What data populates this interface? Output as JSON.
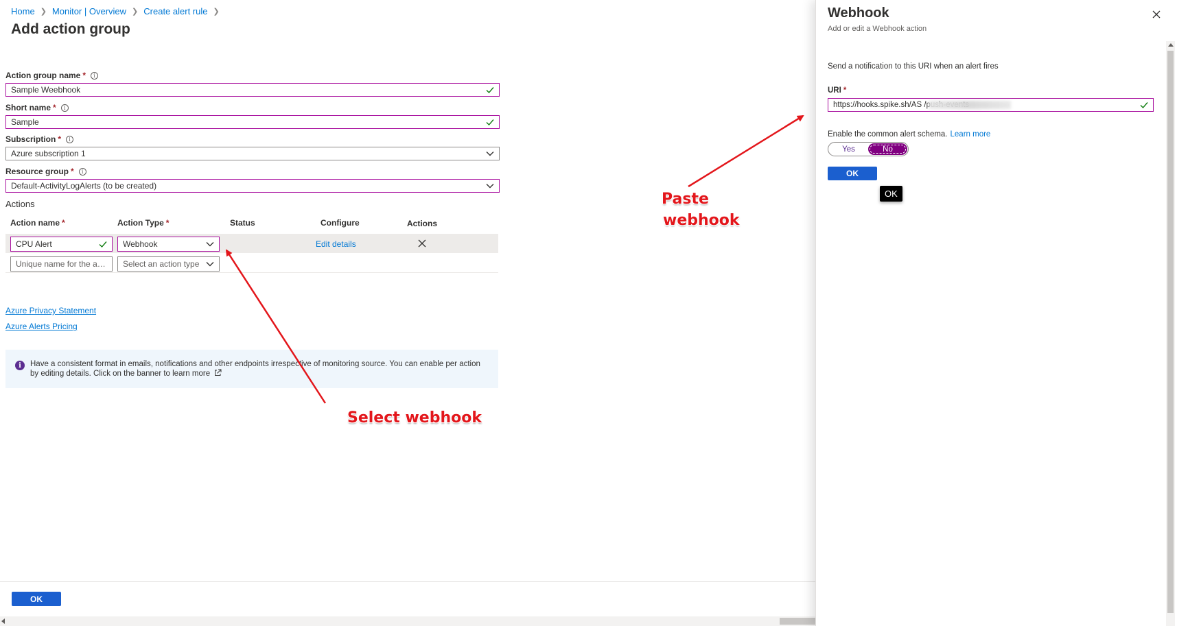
{
  "breadcrumb": [
    {
      "label": "Home"
    },
    {
      "label": "Monitor | Overview"
    },
    {
      "label": "Create alert rule"
    }
  ],
  "page_title": "Add action group",
  "form": {
    "action_group_name": {
      "label": "Action group name",
      "required": "*",
      "value": "Sample Weebhook"
    },
    "short_name": {
      "label": "Short name",
      "required": "*",
      "value": "Sample"
    },
    "subscription": {
      "label": "Subscription",
      "required": "*",
      "value": "Azure subscription 1"
    },
    "resource_group": {
      "label": "Resource group",
      "required": "*",
      "value": "Default-ActivityLogAlerts (to be created)"
    }
  },
  "actions": {
    "section_title": "Actions",
    "columns": {
      "action_name": "Action name",
      "action_type": "Action Type",
      "status": "Status",
      "configure": "Configure",
      "actions": "Actions",
      "required": "*"
    },
    "rows": [
      {
        "name": "CPU Alert",
        "type": "Webhook",
        "configure": "Edit details"
      }
    ],
    "new_row": {
      "name_placeholder": "Unique name for the ac...",
      "type_placeholder": "Select an action type"
    }
  },
  "links": {
    "privacy": "Azure Privacy Statement",
    "pricing": "Azure Alerts Pricing"
  },
  "info_banner": {
    "text": "Have a consistent format in emails, notifications and other endpoints irrespective of monitoring source. You can enable per action by editing details. Click on the banner to learn more"
  },
  "footer": {
    "ok_label": "OK"
  },
  "annotations": {
    "select_webhook": "Select webhook",
    "paste_webhook_line1": "Paste",
    "paste_webhook_line2": "webhook",
    "color": "#e3161b"
  },
  "panel": {
    "title": "Webhook",
    "subtitle": "Add or edit a Webhook action",
    "description": "Send a notification to this URI when an alert fires",
    "uri_label": "URI",
    "uri_required": "*",
    "uri_value": "https://hooks.spike.sh/AS                              /push-events",
    "schema_text": "Enable the common alert schema.",
    "learn_more": "Learn more",
    "toggle": {
      "yes": "Yes",
      "no": "No",
      "selected": "No"
    },
    "ok_label": "OK",
    "tooltip": "OK"
  },
  "colors": {
    "accent_border": "#a80e9e",
    "primary_button": "#1b5fcf",
    "link": "#0078d4",
    "toggle_on": "#800080"
  }
}
